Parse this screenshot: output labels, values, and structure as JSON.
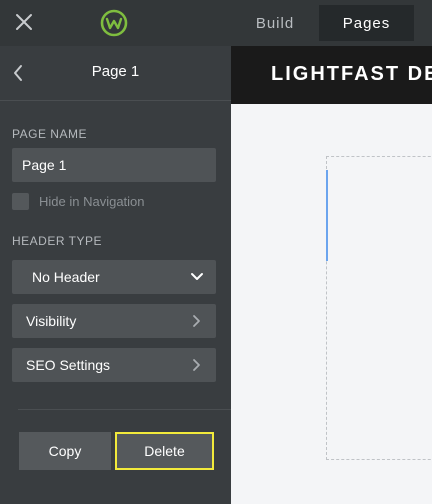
{
  "topbar": {
    "tabs": {
      "build": "Build",
      "pages": "Pages"
    }
  },
  "sidebar": {
    "header": {
      "title": "Page 1"
    },
    "page_name": {
      "label": "PAGE NAME",
      "value": "Page 1"
    },
    "hide_in_nav": {
      "label": "Hide in Navigation",
      "checked": false
    },
    "header_type": {
      "label": "HEADER TYPE",
      "selected": "No Header"
    },
    "visibility": {
      "label": "Visibility"
    },
    "seo": {
      "label": "SEO Settings"
    },
    "actions": {
      "copy": "Copy",
      "delete": "Delete"
    }
  },
  "canvas": {
    "site_title": "LIGHTFAST DE"
  },
  "colors": {
    "highlight": "#f2ea3b",
    "accent_blue": "#6ba4ee",
    "logo_green": "#7fbd3f"
  }
}
